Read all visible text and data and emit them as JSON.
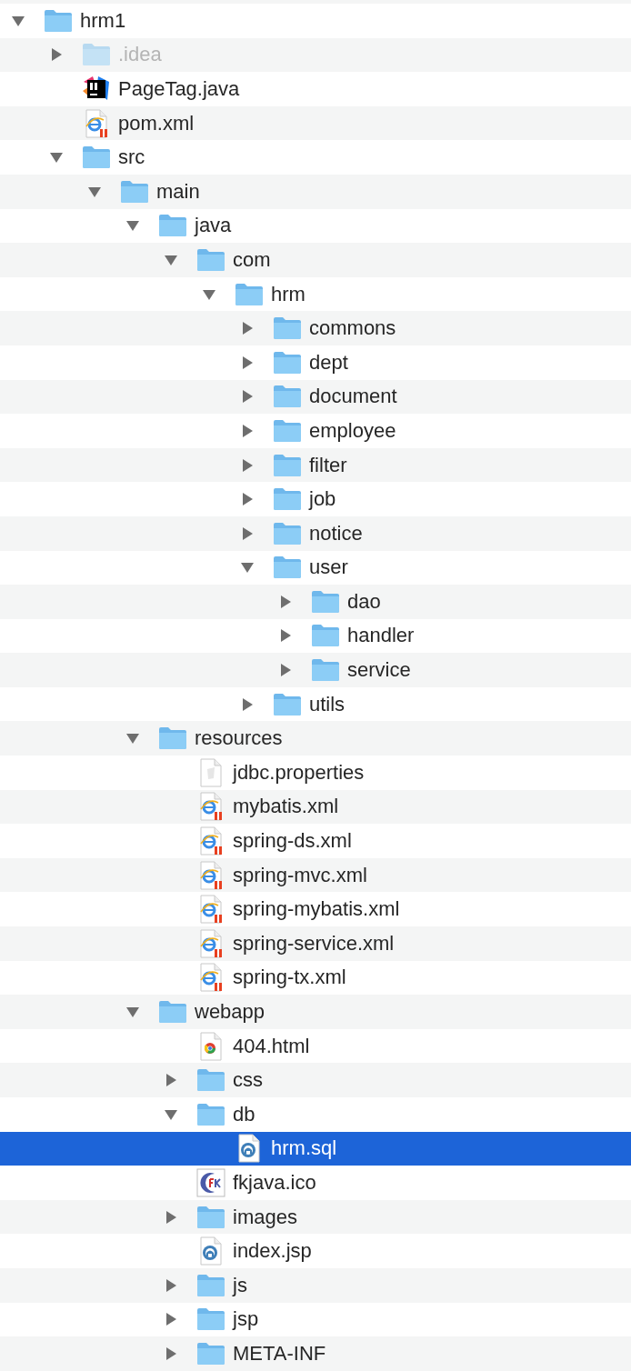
{
  "items": [
    {
      "name": "hrm1",
      "kind": "folder",
      "expanded": true,
      "selected": false,
      "dimmed": false,
      "children": [
        {
          "name": ".idea",
          "kind": "folder",
          "expanded": false,
          "selected": false,
          "dimmed": true
        },
        {
          "name": "PageTag.java",
          "kind": "intellij",
          "selected": false,
          "dimmed": false
        },
        {
          "name": "pom.xml",
          "kind": "xml",
          "selected": false,
          "dimmed": false
        },
        {
          "name": "src",
          "kind": "folder",
          "expanded": true,
          "selected": false,
          "dimmed": false,
          "children": [
            {
              "name": "main",
              "kind": "folder",
              "expanded": true,
              "selected": false,
              "dimmed": false,
              "children": [
                {
                  "name": "java",
                  "kind": "folder",
                  "expanded": true,
                  "selected": false,
                  "dimmed": false,
                  "children": [
                    {
                      "name": "com",
                      "kind": "folder",
                      "expanded": true,
                      "selected": false,
                      "dimmed": false,
                      "children": [
                        {
                          "name": "hrm",
                          "kind": "folder",
                          "expanded": true,
                          "selected": false,
                          "dimmed": false,
                          "children": [
                            {
                              "name": "commons",
                              "kind": "folder",
                              "expanded": false,
                              "selected": false,
                              "dimmed": false
                            },
                            {
                              "name": "dept",
                              "kind": "folder",
                              "expanded": false,
                              "selected": false,
                              "dimmed": false
                            },
                            {
                              "name": "document",
                              "kind": "folder",
                              "expanded": false,
                              "selected": false,
                              "dimmed": false
                            },
                            {
                              "name": "employee",
                              "kind": "folder",
                              "expanded": false,
                              "selected": false,
                              "dimmed": false
                            },
                            {
                              "name": "filter",
                              "kind": "folder",
                              "expanded": false,
                              "selected": false,
                              "dimmed": false
                            },
                            {
                              "name": "job",
                              "kind": "folder",
                              "expanded": false,
                              "selected": false,
                              "dimmed": false
                            },
                            {
                              "name": "notice",
                              "kind": "folder",
                              "expanded": false,
                              "selected": false,
                              "dimmed": false
                            },
                            {
                              "name": "user",
                              "kind": "folder",
                              "expanded": true,
                              "selected": false,
                              "dimmed": false,
                              "children": [
                                {
                                  "name": "dao",
                                  "kind": "folder",
                                  "expanded": false,
                                  "selected": false,
                                  "dimmed": false
                                },
                                {
                                  "name": "handler",
                                  "kind": "folder",
                                  "expanded": false,
                                  "selected": false,
                                  "dimmed": false
                                },
                                {
                                  "name": "service",
                                  "kind": "folder",
                                  "expanded": false,
                                  "selected": false,
                                  "dimmed": false
                                }
                              ]
                            },
                            {
                              "name": "utils",
                              "kind": "folder",
                              "expanded": false,
                              "selected": false,
                              "dimmed": false
                            }
                          ]
                        }
                      ]
                    }
                  ]
                },
                {
                  "name": "resources",
                  "kind": "folder",
                  "expanded": true,
                  "selected": false,
                  "dimmed": false,
                  "children": [
                    {
                      "name": "jdbc.properties",
                      "kind": "text",
                      "selected": false,
                      "dimmed": false
                    },
                    {
                      "name": "mybatis.xml",
                      "kind": "xml",
                      "selected": false,
                      "dimmed": false
                    },
                    {
                      "name": "spring-ds.xml",
                      "kind": "xml",
                      "selected": false,
                      "dimmed": false
                    },
                    {
                      "name": "spring-mvc.xml",
                      "kind": "xml",
                      "selected": false,
                      "dimmed": false
                    },
                    {
                      "name": "spring-mybatis.xml",
                      "kind": "xml",
                      "selected": false,
                      "dimmed": false
                    },
                    {
                      "name": "spring-service.xml",
                      "kind": "xml",
                      "selected": false,
                      "dimmed": false
                    },
                    {
                      "name": "spring-tx.xml",
                      "kind": "xml",
                      "selected": false,
                      "dimmed": false
                    }
                  ]
                },
                {
                  "name": "webapp",
                  "kind": "folder",
                  "expanded": true,
                  "selected": false,
                  "dimmed": false,
                  "children": [
                    {
                      "name": "404.html",
                      "kind": "html",
                      "selected": false,
                      "dimmed": false
                    },
                    {
                      "name": "css",
                      "kind": "folder",
                      "expanded": false,
                      "selected": false,
                      "dimmed": false
                    },
                    {
                      "name": "db",
                      "kind": "folder",
                      "expanded": true,
                      "selected": false,
                      "dimmed": false,
                      "children": [
                        {
                          "name": "hrm.sql",
                          "kind": "script",
                          "selected": true,
                          "dimmed": false
                        }
                      ]
                    },
                    {
                      "name": "fkjava.ico",
                      "kind": "icon",
                      "selected": false,
                      "dimmed": false
                    },
                    {
                      "name": "images",
                      "kind": "folder",
                      "expanded": false,
                      "selected": false,
                      "dimmed": false
                    },
                    {
                      "name": "index.jsp",
                      "kind": "script",
                      "selected": false,
                      "dimmed": false
                    },
                    {
                      "name": "js",
                      "kind": "folder",
                      "expanded": false,
                      "selected": false,
                      "dimmed": false
                    },
                    {
                      "name": "jsp",
                      "kind": "folder",
                      "expanded": false,
                      "selected": false,
                      "dimmed": false
                    },
                    {
                      "name": "META-INF",
                      "kind": "folder",
                      "expanded": false,
                      "selected": false,
                      "dimmed": false
                    }
                  ]
                }
              ]
            }
          ]
        }
      ]
    }
  ]
}
